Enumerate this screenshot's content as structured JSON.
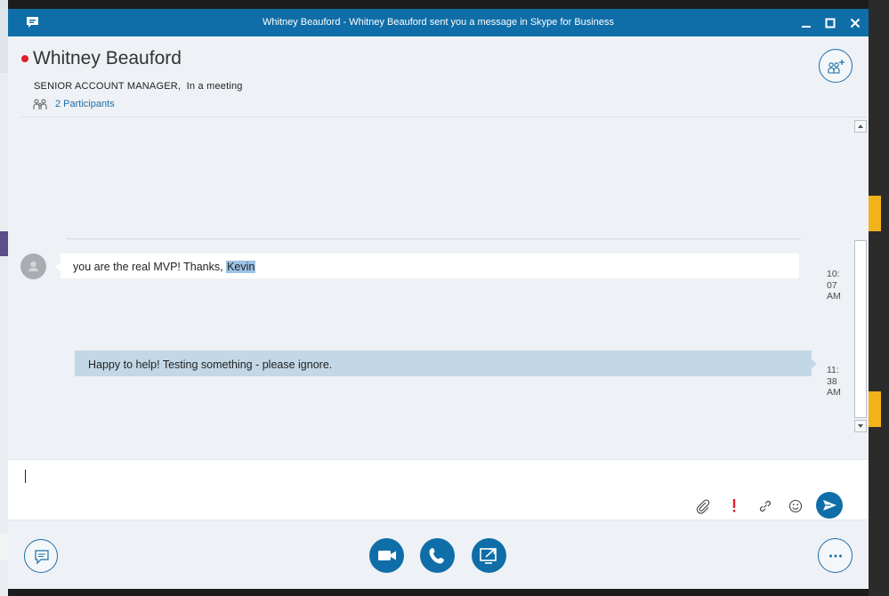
{
  "window": {
    "title": "Whitney Beauford - Whitney Beauford sent you a message in Skype for Business"
  },
  "contact": {
    "name": "Whitney Beauford",
    "job_title": "SENIOR ACCOUNT MANAGER",
    "status": "In a meeting",
    "presence_color": "#e01e2c",
    "participants_label": "2 Participants"
  },
  "messages": [
    {
      "direction": "incoming",
      "text_before": "you are the real MVP! Thanks, ",
      "highlighted": "Kevin",
      "time": "10:\n07\nAM"
    },
    {
      "direction": "outgoing",
      "text": "Happy to help! Testing something - please ignore.",
      "time": "11:\n38\nAM"
    }
  ],
  "compose": {
    "value": "",
    "tools": [
      "attach-icon",
      "important-icon",
      "link-icon",
      "emoticon-icon",
      "send-icon"
    ]
  },
  "footer": {
    "buttons": [
      "conversation-icon",
      "video-icon",
      "call-icon",
      "present-icon",
      "more-options-icon"
    ]
  },
  "colors": {
    "accent": "#0f6ea8",
    "outgoing_bubble": "#c3d8e6",
    "important": "#e01e2c"
  }
}
